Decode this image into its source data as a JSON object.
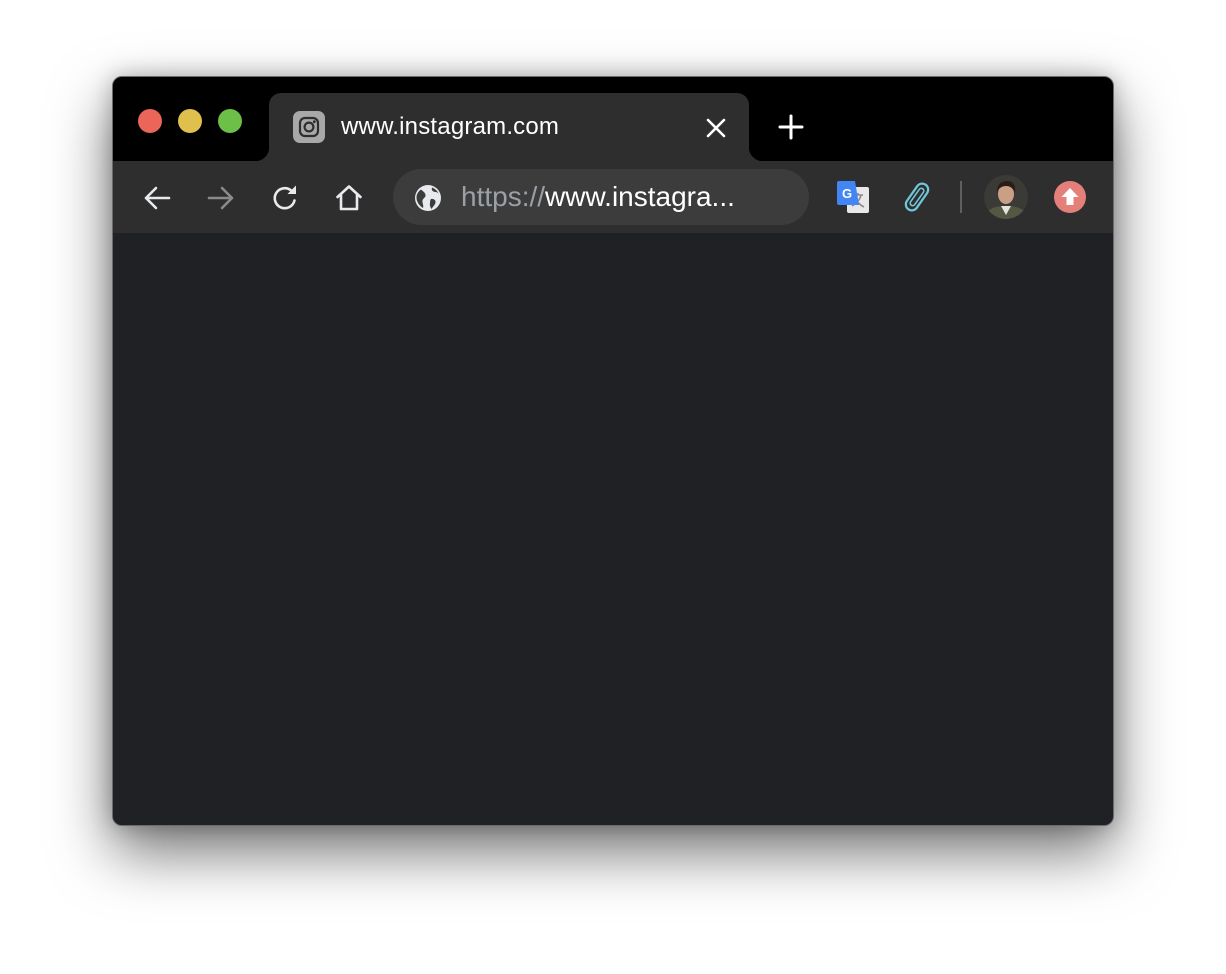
{
  "colors": {
    "close": "#ec6559",
    "minimize": "#e0c04c",
    "zoom": "#6cbf47",
    "tab_background": "#2e2e2e",
    "page_background": "#202124",
    "update_badge": "#e57f7a"
  },
  "tab": {
    "title": "www.instagram.com",
    "favicon": "instagram-icon",
    "close_icon": "close-icon"
  },
  "new_tab_icon": "plus-icon",
  "nav": {
    "back_icon": "arrow-left-icon",
    "forward_icon": "arrow-right-icon",
    "forward_enabled": false,
    "reload_icon": "reload-icon",
    "home_icon": "home-icon"
  },
  "omnibox": {
    "security_icon": "globe-icon",
    "url_scheme": "https://",
    "url_host": "www.instagra..."
  },
  "extensions": [
    {
      "name": "google-translate",
      "icon": "google-translate-icon"
    },
    {
      "name": "clipper",
      "icon": "paperclip-icon"
    }
  ],
  "profile": {
    "icon": "avatar"
  },
  "update": {
    "icon": "arrow-up-icon"
  }
}
